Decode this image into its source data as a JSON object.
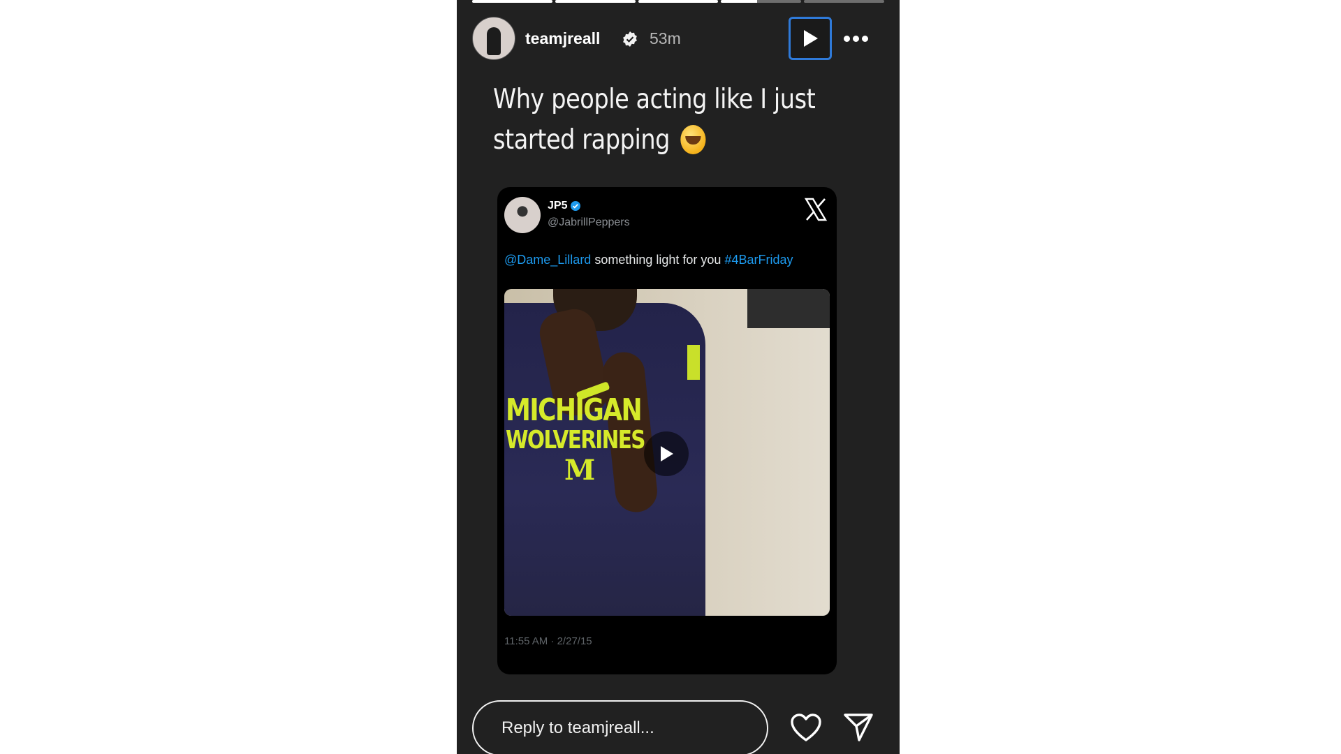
{
  "story": {
    "progress": {
      "segments": 5,
      "completed": 3,
      "active_index": 3,
      "active_fraction": 0.45
    },
    "header": {
      "username": "teamjreall",
      "verified": true,
      "time": "53m"
    },
    "caption": "Why people acting like I just started rapping",
    "embedded_tweet": {
      "display_name": "JP5",
      "handle": "@JabrillPeppers",
      "mention": "@Dame_Lillard",
      "body": " something light for you ",
      "hashtag": "#4BarFriday",
      "shirt_line1": "MICHIGAN",
      "shirt_line2": "WOLVERINES",
      "shirt_logo": "M",
      "timestamp": "11:55 AM · 2/27/15"
    },
    "reply": {
      "placeholder": "Reply to teamjreall..."
    }
  },
  "icons": [
    "verified-icon",
    "play-icon",
    "more-icon",
    "x-logo-icon",
    "video-play-icon",
    "heart-icon",
    "send-icon"
  ],
  "colors": {
    "background": "#212121",
    "accent": "#2f7ad9",
    "link": "#1d9bf0",
    "shirt_text": "#d6ea2a"
  }
}
